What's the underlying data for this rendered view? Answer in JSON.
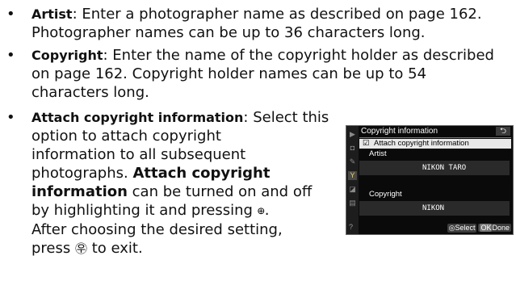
{
  "items": [
    {
      "term": "Artist",
      "lines": [
        "Enter a photographer name as described on page 162.",
        "Photographer names can be up to 36 characters long."
      ]
    },
    {
      "term": "Copyright",
      "lines": [
        "Enter the name of the copyright holder as described",
        "on page 162.  Copyright holder names can be up to 54",
        "characters long."
      ]
    },
    {
      "term": "Attach copyright information",
      "lines_first": ": Select this",
      "lines": [
        "option to attach copyright",
        "information to all subsequent",
        "photographs. "
      ],
      "bold_inline_1": "Attach copyright",
      "bold_inline_2": "information",
      "after_bold": " can be turned on and off",
      "line_press_pre": "by highlighting it and pressing ",
      "line_press_post": ".",
      "line_after": "After choosing the desired setting,",
      "line_exit_pre": "press ",
      "line_exit_post": " to exit."
    }
  ],
  "screen": {
    "title": "Copyright information",
    "back_icon": "⮌",
    "checkbox": "☑",
    "attach_label": "Attach copyright information",
    "artist_label": "Artist",
    "artist_value": "NIKON TARO",
    "copyright_label": "Copyright",
    "copyright_value": "NIKON",
    "footer_select": "Select",
    "footer_done": "Done",
    "ok_label": "OK",
    "help": "?"
  },
  "glyphs": {
    "multi_selector": "⊕",
    "ok_button": "㉾"
  }
}
